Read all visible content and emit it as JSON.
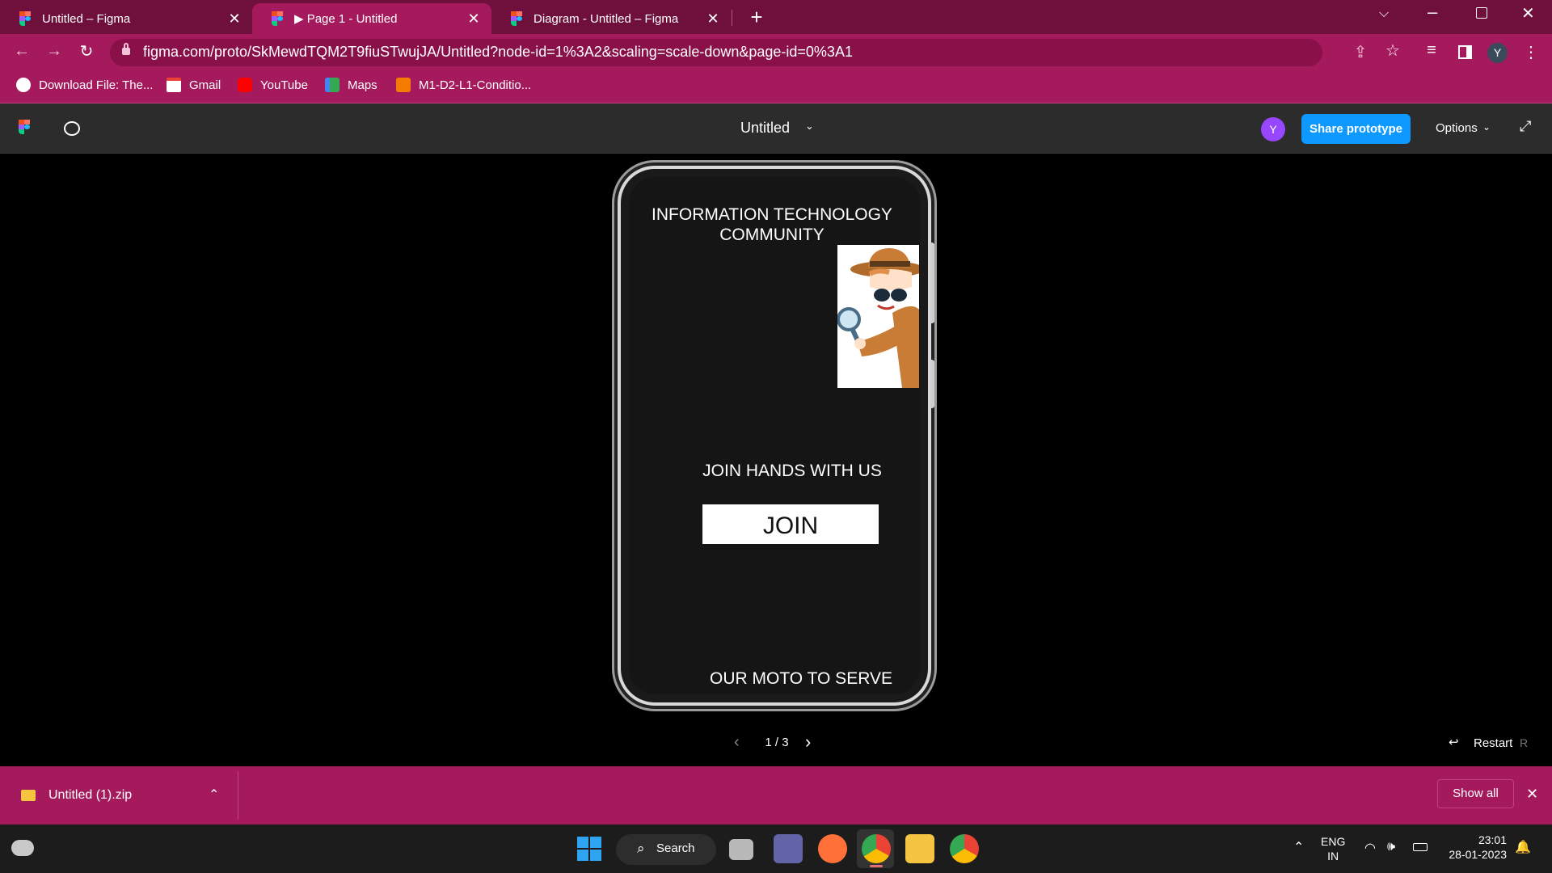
{
  "browser": {
    "tabs": [
      {
        "label": "Untitled – Figma",
        "active": false
      },
      {
        "label": "▶ Page 1 - Untitled",
        "active": true
      },
      {
        "label": "Diagram - Untitled – Figma",
        "active": false
      }
    ],
    "new_tab": "+",
    "url": "figma.com/proto/SkMewdTQM2T9fiuSTwujJA/Untitled?node-id=1%3A2&scaling=scale-down&page-id=0%3A1",
    "profile_initial": "Y",
    "bookmarks": [
      {
        "label": "Download File: The..."
      },
      {
        "label": "Gmail"
      },
      {
        "label": "YouTube"
      },
      {
        "label": "Maps"
      },
      {
        "label": "M1-D2-L1-Conditio..."
      }
    ]
  },
  "figma": {
    "file_title": "Untitled",
    "avatar_initial": "Y",
    "share_button": "Share prototype",
    "options_label": "Options",
    "page_counter": "1 / 3",
    "restart_label": "Restart",
    "restart_shortcut": "R"
  },
  "prototype": {
    "heading_line1": "INFORMATION TECHNOLOGY",
    "heading_line2": "COMMUNITY",
    "join_text": "JOIN HANDS WITH US",
    "join_button": "JOIN",
    "footer_text": "OUR MOTO TO SERVE"
  },
  "download": {
    "filename": "Untitled (1).zip",
    "show_all": "Show all"
  },
  "taskbar": {
    "search_label": "Search",
    "lang_line1": "ENG",
    "lang_line2": "IN",
    "time": "23:01",
    "date": "28-01-2023"
  },
  "colors": {
    "tabstrip": "#6e0f3c",
    "toolbar": "#a51a5c",
    "figma_header": "#2c2c2c",
    "share_blue": "#0d99ff",
    "avatar_purple": "#9747ff"
  }
}
